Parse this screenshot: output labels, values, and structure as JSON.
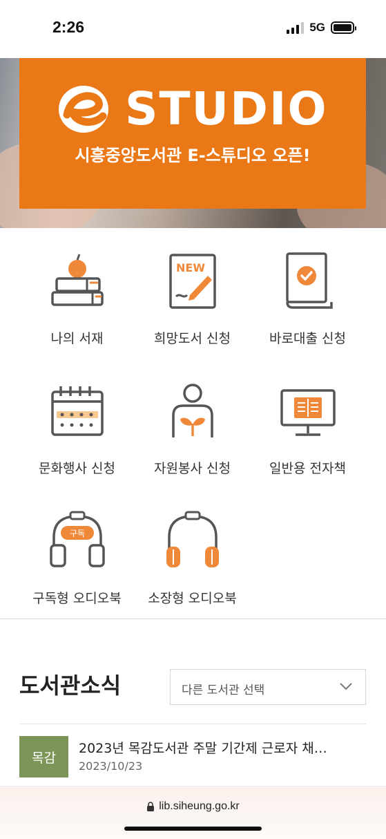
{
  "status": {
    "time": "2:26",
    "network": "5G"
  },
  "banner": {
    "logo_text": "STUDIO",
    "subtitle": "시흥중앙도서관 E-스튜디오 오픈!"
  },
  "menu": [
    {
      "label": "나의 서재",
      "icon": "books-apple-icon"
    },
    {
      "label": "희망도서 신청",
      "icon": "new-book-pen-icon"
    },
    {
      "label": "바로대출 신청",
      "icon": "book-check-icon"
    },
    {
      "label": "문화행사 신청",
      "icon": "calendar-icon"
    },
    {
      "label": "자원봉사 신청",
      "icon": "volunteer-sprout-icon"
    },
    {
      "label": "일반용 전자책",
      "icon": "monitor-ebook-icon"
    },
    {
      "label": "구독형 오디오북",
      "icon": "subscribe-headphones-icon",
      "badge": "구독"
    },
    {
      "label": "소장형 오디오북",
      "icon": "headphones-icon"
    }
  ],
  "news": {
    "title": "도서관소식",
    "select_placeholder": "다른 도서관 선택",
    "items": [
      {
        "badge": "목감",
        "text": "2023년 목감도서관 주말 기간제 근로자 채…",
        "date": "2023/10/23"
      }
    ]
  },
  "browser": {
    "url": "lib.siheung.go.kr"
  },
  "colors": {
    "accent": "#ea7817",
    "badge_green": "#7a9557",
    "icon_gray": "#555555",
    "icon_orange": "#f0883a"
  }
}
